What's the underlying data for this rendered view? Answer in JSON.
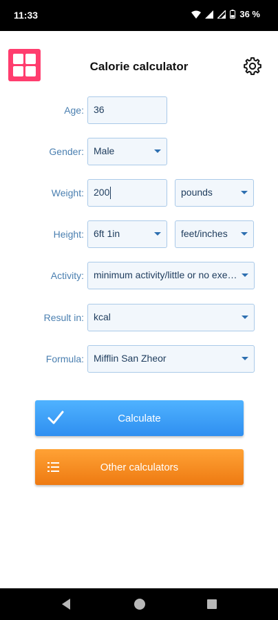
{
  "status_bar": {
    "time": "11:33",
    "battery": "36 %"
  },
  "header": {
    "title": "Calorie calculator"
  },
  "form": {
    "age": {
      "label": "Age:",
      "value": "36"
    },
    "gender": {
      "label": "Gender:",
      "value": "Male"
    },
    "weight": {
      "label": "Weight:",
      "value": "200",
      "unit": "pounds"
    },
    "height": {
      "label": "Height:",
      "value": "6ft 1in",
      "unit": "feet/inches"
    },
    "activity": {
      "label": "Activity:",
      "value": "minimum activity/little or no exercise"
    },
    "result": {
      "label": "Result in:",
      "value": "kcal"
    },
    "formula": {
      "label": "Formula:",
      "value": "Mifflin San Zheor"
    }
  },
  "buttons": {
    "calculate": "Calculate",
    "other": "Other calculators"
  },
  "colors": {
    "accent": "#2f8ff0",
    "secondary": "#ee7a12",
    "logo": "#ff3d6e",
    "label": "#4a7fb0"
  }
}
